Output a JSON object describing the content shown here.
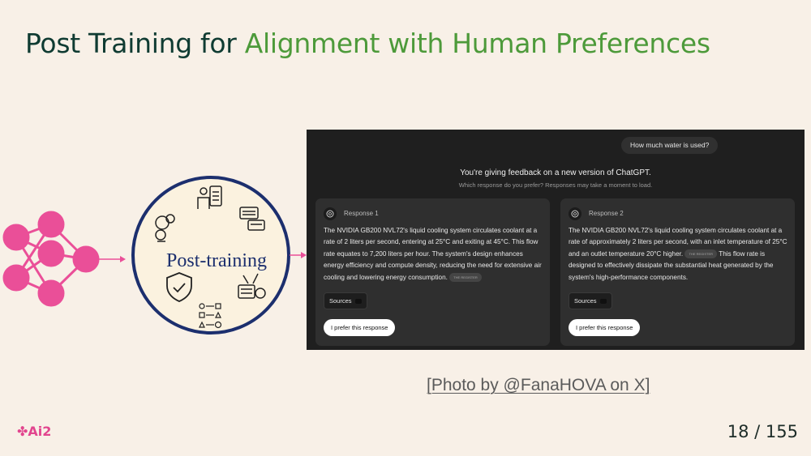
{
  "slide": {
    "title_part1": "Post Training for ",
    "title_part2": "Alignment with Human Preferences",
    "diagram_label": "Post-training",
    "credit": "[Photo by @FanaHOVA on X]",
    "logo_text": "Ai2",
    "page_current": "18",
    "page_separator": "/",
    "page_total": "155",
    "colors": {
      "title": "#0f3b32",
      "highlight": "#4d9a3a",
      "pink": "#ea4f98",
      "navy": "#1c2f6e",
      "background": "#f8f0e7"
    }
  },
  "screenshot": {
    "question": "How much water is used?",
    "feedback_heading": "You're giving feedback on a new version of ChatGPT.",
    "feedback_sub": "Which response do you prefer? Responses may take a moment to load.",
    "responses": [
      {
        "label": "Response 1",
        "text": "The NVIDIA GB200 NVL72's liquid cooling system circulates coolant at a rate of 2 liters per second, entering at 25°C and exiting at 45°C. This flow rate equates to 7,200 liters per hour. The system's design enhances energy efficiency and compute density, reducing the need for extensive air cooling and lowering energy consumption.",
        "tag": "THE REGISTER",
        "sources": "Sources",
        "prefer": "I prefer this response"
      },
      {
        "label": "Response 2",
        "text_a": "The NVIDIA GB200 NVL72's liquid cooling system circulates coolant at a rate of approximately 2 liters per second, with an inlet temperature of 25°C and an outlet temperature 20°C higher.",
        "tag": "THE REGISTER",
        "text_b": "This flow rate is designed to effectively dissipate the substantial heat generated by the system's high-performance components.",
        "sources": "Sources",
        "prefer": "I prefer this response"
      }
    ]
  }
}
